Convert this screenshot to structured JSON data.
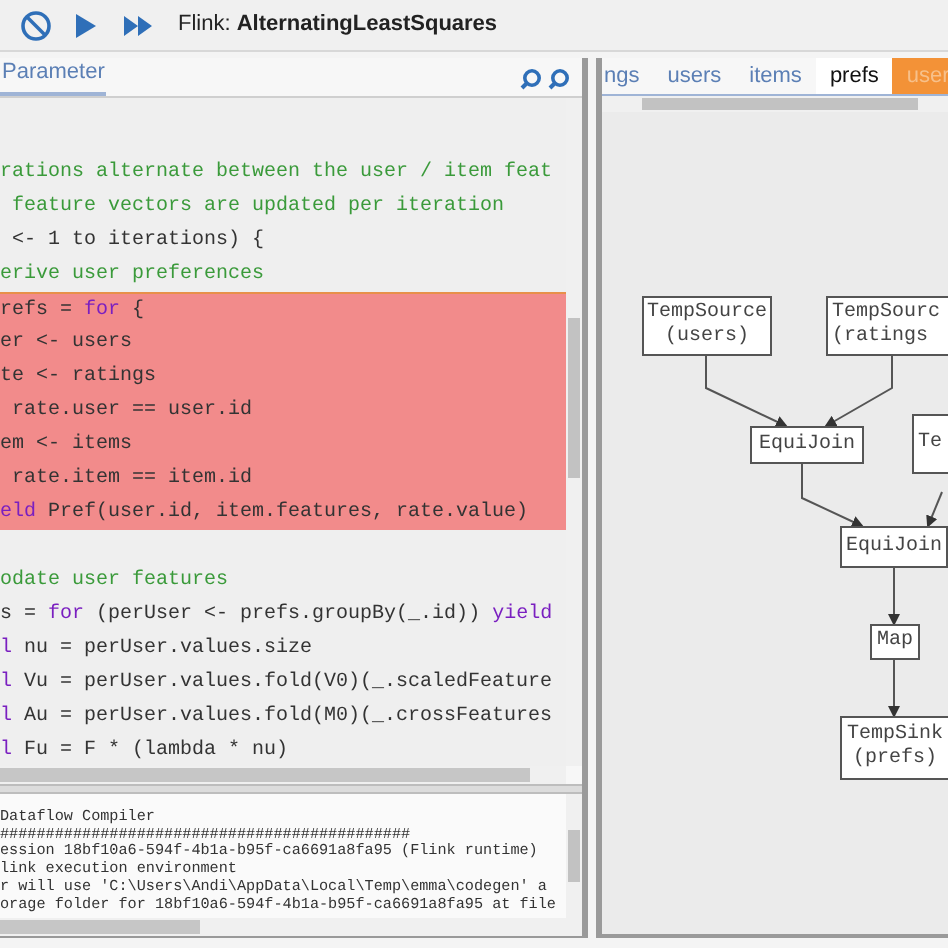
{
  "window": {
    "title": "Flink: **AlternatingLeastSquares**"
  },
  "editor": {
    "tab": "Parameter",
    "lines": [
      {
        "highlighted": false,
        "tokens": [
          {
            "kind": "comment",
            "text": "rations alternate between the user / item feat"
          }
        ]
      },
      {
        "highlighted": false,
        "tokens": [
          {
            "kind": "comment",
            "text": " feature vectors are updated per iteration"
          }
        ]
      },
      {
        "highlighted": false,
        "tokens": [
          {
            "kind": "plain",
            "text": " <- 1 to iterations) {"
          }
        ]
      },
      {
        "highlighted": false,
        "tokens": [
          {
            "kind": "comment",
            "text": "erive user preferences"
          }
        ]
      },
      {
        "highlighted": true,
        "tokens": [
          {
            "kind": "plain",
            "text": "refs = "
          },
          {
            "kind": "keyword",
            "text": "for"
          },
          {
            "kind": "plain",
            "text": " {"
          }
        ]
      },
      {
        "highlighted": true,
        "tokens": [
          {
            "kind": "plain",
            "text": "er <- users"
          }
        ]
      },
      {
        "highlighted": true,
        "tokens": [
          {
            "kind": "plain",
            "text": "te <- ratings"
          }
        ]
      },
      {
        "highlighted": true,
        "tokens": [
          {
            "kind": "plain",
            "text": " rate.user == user.id"
          }
        ]
      },
      {
        "highlighted": true,
        "tokens": [
          {
            "kind": "plain",
            "text": "em <- items"
          }
        ]
      },
      {
        "highlighted": true,
        "tokens": [
          {
            "kind": "plain",
            "text": " rate.item == item.id"
          }
        ]
      },
      {
        "highlighted": true,
        "tokens": [
          {
            "kind": "keyword",
            "text": "eld"
          },
          {
            "kind": "plain",
            "text": " Pref(user.id, item.features, rate.value)"
          }
        ]
      },
      {
        "highlighted": false
      },
      {
        "highlighted": false,
        "tokens": [
          {
            "kind": "comment",
            "text": "odate user features"
          }
        ]
      },
      {
        "highlighted": false,
        "tokens": [
          {
            "kind": "plain",
            "text": "s = "
          },
          {
            "kind": "keyword",
            "text": "for"
          },
          {
            "kind": "plain",
            "text": " (perUser <- prefs.groupBy(_.id)) "
          },
          {
            "kind": "keyword",
            "text": "yield"
          }
        ]
      },
      {
        "highlighted": false,
        "tokens": [
          {
            "kind": "keyword",
            "text": "l"
          },
          {
            "kind": "plain",
            "text": " nu = perUser.values.size"
          }
        ]
      },
      {
        "highlighted": false,
        "tokens": [
          {
            "kind": "keyword",
            "text": "l"
          },
          {
            "kind": "plain",
            "text": " Vu = perUser.values.fold(V0)(_.scaledFeature"
          }
        ]
      },
      {
        "highlighted": false,
        "tokens": [
          {
            "kind": "keyword",
            "text": "l"
          },
          {
            "kind": "plain",
            "text": " Au = perUser.values.fold(M0)(_.crossFeatures"
          }
        ]
      },
      {
        "highlighted": false,
        "tokens": [
          {
            "kind": "keyword",
            "text": "l"
          },
          {
            "kind": "plain",
            "text": " Fu = F * (lambda * nu)"
          }
        ]
      }
    ]
  },
  "console": {
    "lines": [
      "Dataflow Compiler",
      "#############################################",
      "ession 18bf10a6-594f-4b1a-b95f-ca6691a8fa95 (Flink runtime)",
      "link execution environment",
      "r will use 'C:\\Users\\Andi\\AppData\\Local\\Temp\\emma\\codegen' a",
      "orage folder for 18bf10a6-594f-4b1a-b95f-ca6691a8fa95 at file"
    ]
  },
  "graph": {
    "tabs": [
      {
        "label": "ngs",
        "selected": false,
        "highlighted": false
      },
      {
        "label": "users",
        "selected": false,
        "highlighted": false
      },
      {
        "label": "items",
        "selected": false,
        "highlighted": false
      },
      {
        "label": "prefs",
        "selected": true,
        "highlighted": false
      },
      {
        "label": "user",
        "selected": false,
        "highlighted": true
      }
    ],
    "nodes": [
      {
        "lines": [
          "TempSource",
          "(users)"
        ]
      },
      {
        "lines": [
          "TempSourc",
          "(ratings"
        ]
      },
      {
        "lines": [
          "EquiJoin"
        ]
      },
      {
        "lines": [
          "Te"
        ]
      },
      {
        "lines": [
          "EquiJoin"
        ]
      },
      {
        "lines": [
          "Map"
        ]
      },
      {
        "lines": [
          "TempSink",
          "(prefs)"
        ]
      }
    ]
  }
}
